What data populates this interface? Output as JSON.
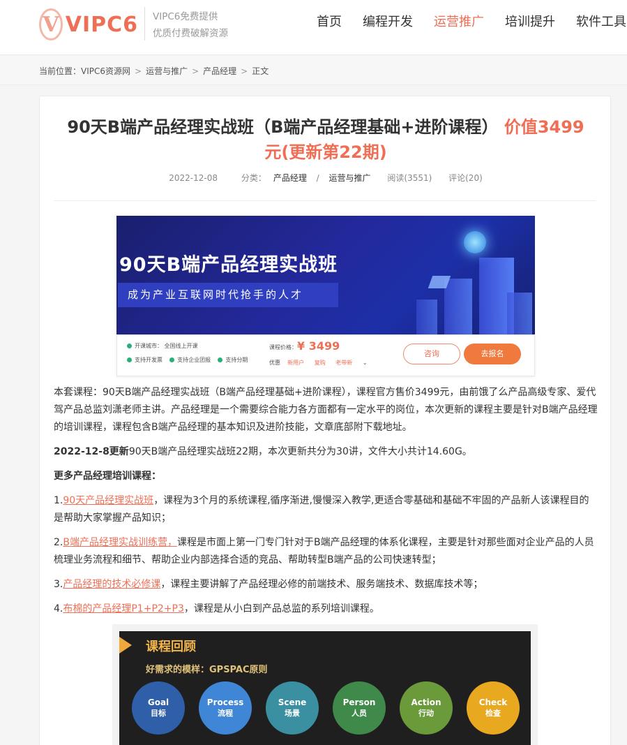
{
  "header": {
    "logo_mark": "V",
    "logo_text": "VIPC6",
    "slogan_line1": "VIPC6免费提供",
    "slogan_line2": "优质付费破解资源",
    "nav": [
      "首页",
      "编程开发",
      "运营推广",
      "培训提升",
      "软件工具"
    ],
    "active_nav": "运营推广",
    "accent_color": "#ef6f56"
  },
  "breadcrumb": {
    "prefix": "当前位置：",
    "items": [
      "VIPC6资源网",
      "运营与推广",
      "产品经理",
      "正文"
    ],
    "separator": ">"
  },
  "article": {
    "title_main": "90天B端产品经理实战班（B端产品经理基础+进阶课程）",
    "title_price_line1": "价值3499",
    "title_price_line2": "元(更新第22期)",
    "date": "2022-12-08",
    "category_label": "分类：",
    "category_1": "产品经理",
    "category_sep": "/",
    "category_2": "运营与推广",
    "views": "阅读(3551)",
    "comments": "评论(20)"
  },
  "banner": {
    "title": "90天B端产品经理实战班",
    "subtitle": "成为产业互联网时代抢手的人才",
    "city_label": "开课城市：",
    "city_value": "全国线上开课",
    "feature_1": "支持开发票",
    "feature_2": "支持企业团报",
    "feature_3": "支持分期",
    "price_label": "课程价格：",
    "price": "¥ 3499",
    "discount_label": "优惠",
    "discount_1": "新用户",
    "discount_2": "复购",
    "discount_3": "老带新",
    "consult_button": "咨询",
    "signup_button": "去报名"
  },
  "content": {
    "intro": "本套课程：90天B端产品经理实战班（B端产品经理基础+进阶课程），课程官方售价3499元，由前饿了么产品高级专家、爱代驾产品总监刘潇老师主讲。产品经理是一个需要综合能力各方面都有一定水平的岗位，本次更新的课程主要是针对B端产品经理的培训课程，课程包含B端产品经理的基本知识及进阶技能，文章底部附下载地址。",
    "update_bold": "2022-12-8更新",
    "update_text": "90天B端产品经理实战班22期，本次更新共分为30讲，文件大小共计14.60G。",
    "more_heading": "更多产品经理培训课程：",
    "item1_num": "1.",
    "item1_link": "90天产品经理实战班",
    "item1_text": "，课程为3个月的系统课程,循序渐进,慢慢深入教学,更适合零基础和基础不牢固的产品新人该课程目的是帮助大家掌握产品知识；",
    "item2_num": "2.",
    "item2_link": "B端产品经理实战训练营，",
    "item2_text": "课程是市面上第一门专门针对于B端产品经理的体系化课程，主要是针对那些面对企业产品的人员梳理业务流程和细节、帮助企业内部选择合适的竞品、帮助转型B端产品的公司快速转型；",
    "item3_num": "3.",
    "item3_link": "产品经理的技术必修课",
    "item3_text": "，课程主要讲解了产品经理必修的前端技术、服务端技术、数据库技术等；",
    "item4_num": "4.",
    "item4_link": "布棉的产品经理P1+P2+P3",
    "item4_text": "，课程是从小白到产品总监的系列培训课程。"
  },
  "review_image": {
    "title": "课程回顾",
    "subtitle": "好需求的模样：GPSPAC原则",
    "circles": [
      {
        "en": "Goal",
        "zh": "目标",
        "color": "#2f5fa8"
      },
      {
        "en": "Process",
        "zh": "流程",
        "color": "#3f86d6"
      },
      {
        "en": "Scene",
        "zh": "场景",
        "color": "#3a8fa0"
      },
      {
        "en": "Person",
        "zh": "人员",
        "color": "#3f8a4a"
      },
      {
        "en": "Action",
        "zh": "行动",
        "color": "#6a9a3a"
      },
      {
        "en": "Check",
        "zh": "检查",
        "color": "#e8a820"
      }
    ]
  }
}
